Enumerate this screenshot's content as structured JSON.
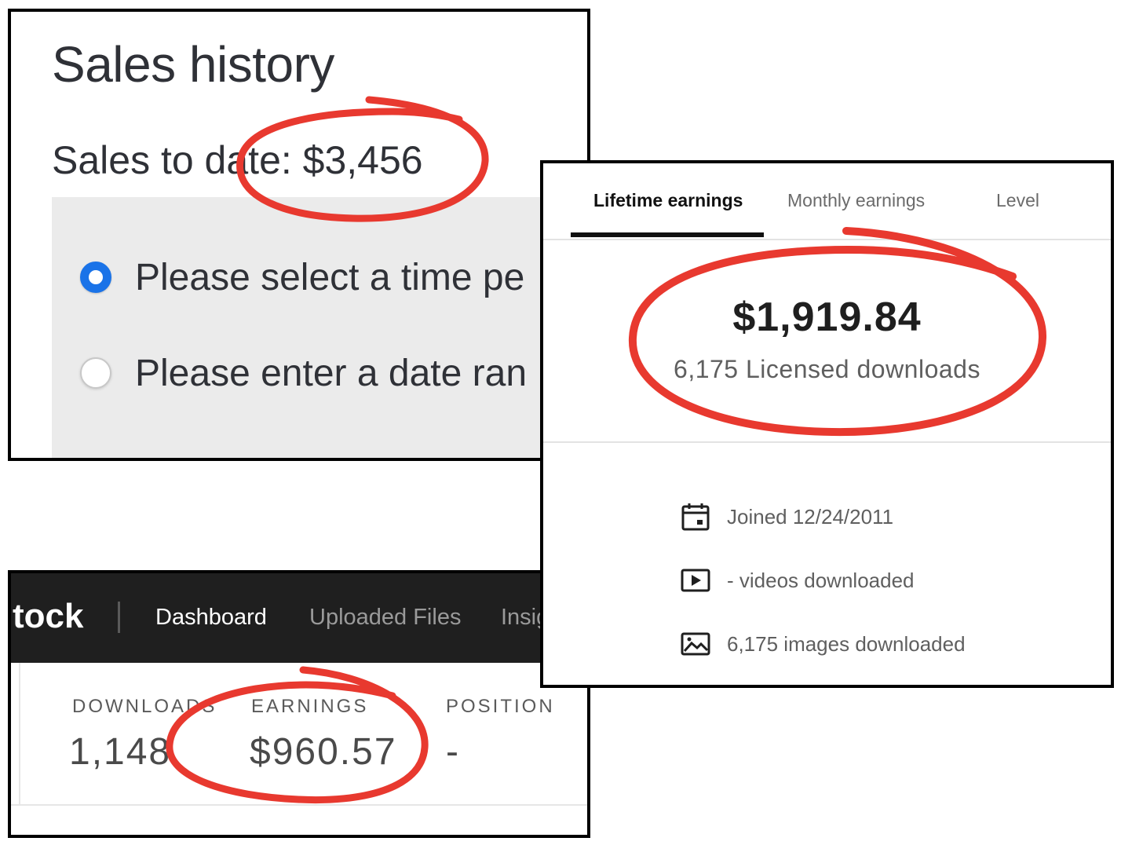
{
  "sales_panel": {
    "title": "Sales history",
    "sales_to_date": "Sales to date: $3,456",
    "radio_options": [
      {
        "label": "Please select a time pe",
        "selected": true
      },
      {
        "label": "Please enter a date ran",
        "selected": false
      }
    ]
  },
  "earnings_panel": {
    "tabs": [
      {
        "label": "Lifetime earnings",
        "active": true
      },
      {
        "label": "Monthly earnings",
        "active": false
      },
      {
        "label": "Level",
        "active": false
      }
    ],
    "amount": "$1,919.84",
    "licensed_downloads": "6,175 Licensed downloads",
    "info": [
      {
        "icon": "calendar-icon",
        "text": "Joined 12/24/2011"
      },
      {
        "icon": "video-play-icon",
        "text": "- videos downloaded"
      },
      {
        "icon": "image-icon",
        "text": "6,175 images downloaded"
      }
    ]
  },
  "stock_panel": {
    "brand": "tock",
    "nav": [
      {
        "label": "Dashboard",
        "active": true
      },
      {
        "label": "Uploaded Files",
        "active": false
      },
      {
        "label": "Insig",
        "active": false
      }
    ],
    "stats": [
      {
        "label": "DOWNLOADS",
        "value": "1,148"
      },
      {
        "label": "EARNINGS",
        "value": "$960.57"
      },
      {
        "label": "POSITION",
        "value": "-"
      }
    ]
  },
  "colors": {
    "annotation_red": "#e8392f",
    "radio_blue": "#1a73e8",
    "navbar_bg": "#1f1f1f"
  }
}
